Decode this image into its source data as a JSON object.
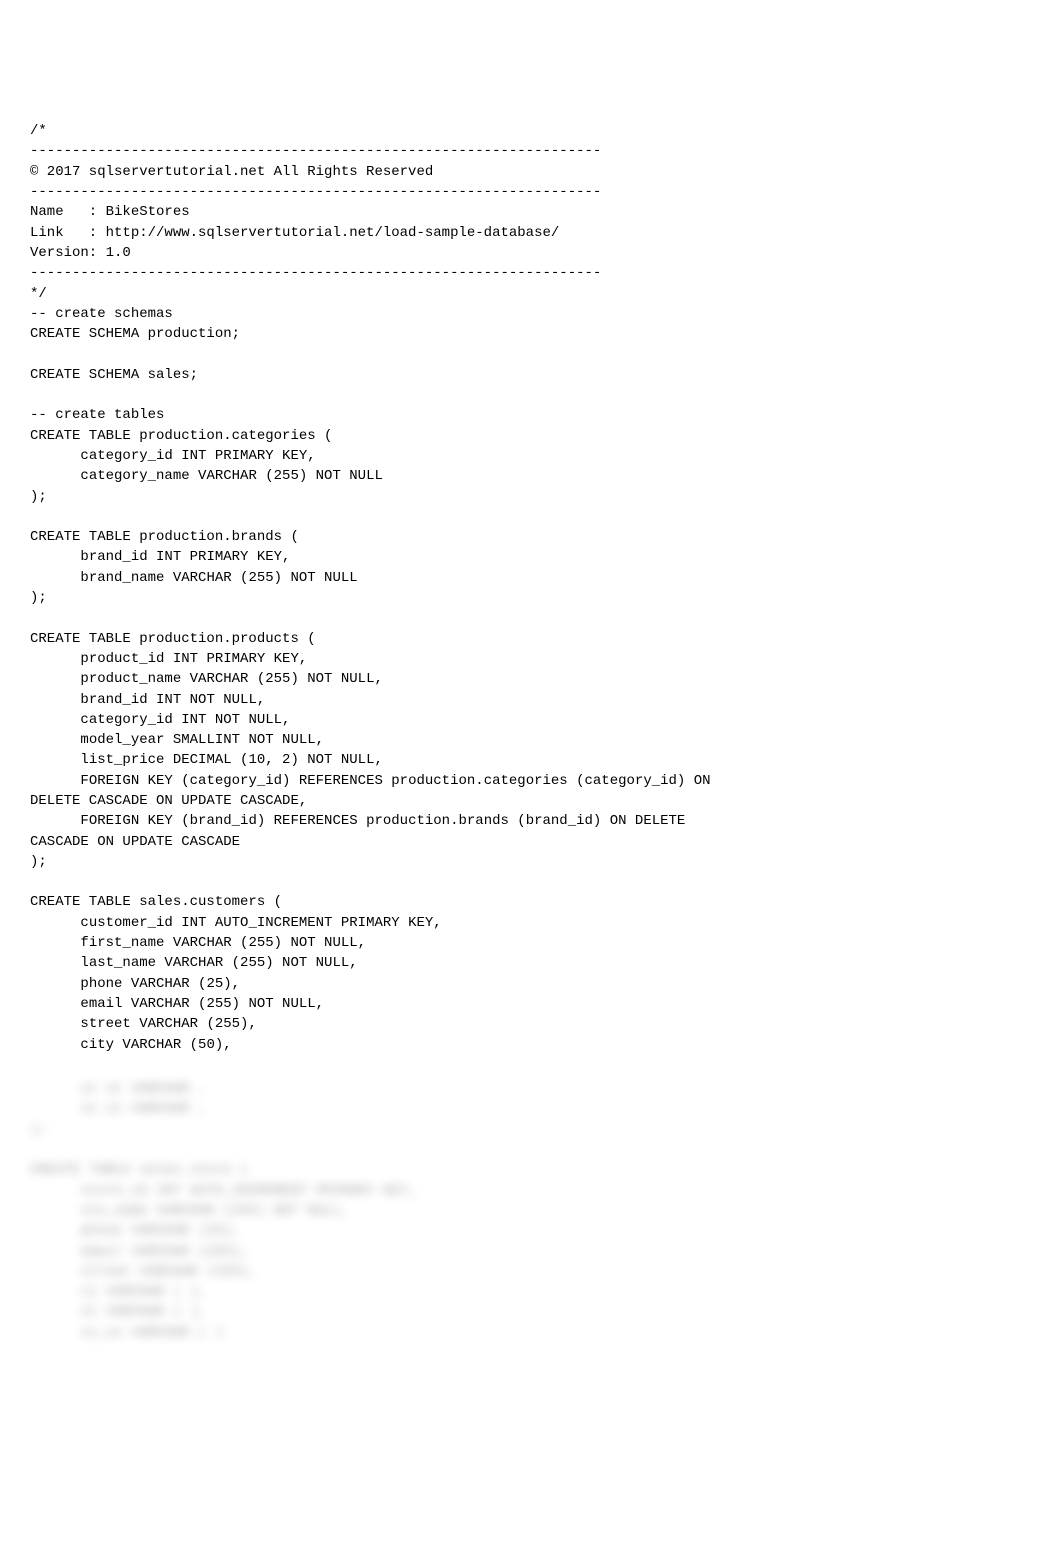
{
  "code": "/*\n--------------------------------------------------------------------\n© 2017 sqlservertutorial.net All Rights Reserved\n--------------------------------------------------------------------\nName   : BikeStores\nLink   : http://www.sqlservertutorial.net/load-sample-database/\nVersion: 1.0\n--------------------------------------------------------------------\n*/\n-- create schemas\nCREATE SCHEMA production;\n\nCREATE SCHEMA sales;\n\n-- create tables\nCREATE TABLE production.categories (\n      category_id INT PRIMARY KEY,\n      category_name VARCHAR (255) NOT NULL\n);\n\nCREATE TABLE production.brands (\n      brand_id INT PRIMARY KEY,\n      brand_name VARCHAR (255) NOT NULL\n);\n\nCREATE TABLE production.products (\n      product_id INT PRIMARY KEY,\n      product_name VARCHAR (255) NOT NULL,\n      brand_id INT NOT NULL,\n      category_id INT NOT NULL,\n      model_year SMALLINT NOT NULL,\n      list_price DECIMAL (10, 2) NOT NULL,\n      FOREIGN KEY (category_id) REFERENCES production.categories (category_id) ON\nDELETE CASCADE ON UPDATE CASCADE,\n      FOREIGN KEY (brand_id) REFERENCES production.brands (brand_id) ON DELETE\nCASCADE ON UPDATE CASCADE\n);\n\nCREATE TABLE sales.customers (\n      customer_id INT AUTO_INCREMENT PRIMARY KEY,\n      first_name VARCHAR (255) NOT NULL,\n      last_name VARCHAR (255) NOT NULL,\n      phone VARCHAR (25),\n      email VARCHAR (255) NOT NULL,\n      street VARCHAR (255),\n      city VARCHAR (50),",
  "blurred": "      st st VARCHAR ,\n      zi zi VARCHAR ,\n);\n\nCREATE TABLE sales.store (\n      store_id INT AUTO_INCREMENT PRIMARY KEY,\n      sto_name VARCHAR (255) NOT NULL,\n      phone VARCHAR (25),\n      email VARCHAR (255),\n      street VARCHAR (255),\n      ci VARCHAR ( ),\n      st VARCHAR ( ),\n      zi_co VARCHAR ( )"
}
